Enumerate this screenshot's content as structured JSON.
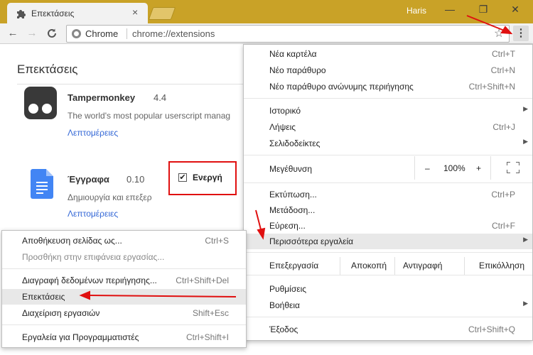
{
  "window": {
    "tab_title": "Επεκτάσεις",
    "tab_close": "×",
    "user": "Haris",
    "controls": {
      "minimize": "—",
      "maximize": "❐",
      "close": "✕"
    }
  },
  "toolbar": {
    "back": "←",
    "forward": "→",
    "reload": "C",
    "chip": "Chrome",
    "url": "chrome://extensions",
    "star": "☆",
    "menu": "⋮"
  },
  "page": {
    "title": "Επεκτάσεις",
    "extensions": [
      {
        "name": "Tampermonkey",
        "version": "4.4",
        "description": "The world's most popular userscript manag",
        "details": "Λεπτομέρειες"
      },
      {
        "name": "Έγγραφα",
        "version": "0.10",
        "description": "Δημιουργία και επεξερ",
        "details": "Λεπτομέρειες",
        "enabled_label": "Ενεργή"
      }
    ]
  },
  "main_menu": {
    "new_tab": {
      "label": "Νέα καρτέλα",
      "shortcut": "Ctrl+T"
    },
    "new_window": {
      "label": "Νέο παράθυρο",
      "shortcut": "Ctrl+N"
    },
    "incognito": {
      "label": "Νέο παράθυρο ανώνυμης περιήγησης",
      "shortcut": "Ctrl+Shift+N"
    },
    "history": {
      "label": "Ιστορικό"
    },
    "downloads": {
      "label": "Λήψεις",
      "shortcut": "Ctrl+J"
    },
    "bookmarks": {
      "label": "Σελιδοδείκτες"
    },
    "zoom": {
      "label": "Μεγέθυνση",
      "minus": "–",
      "value": "100%",
      "plus": "+"
    },
    "print": {
      "label": "Εκτύπωση...",
      "shortcut": "Ctrl+P"
    },
    "cast": {
      "label": "Μετάδοση..."
    },
    "find": {
      "label": "Εύρεση...",
      "shortcut": "Ctrl+F"
    },
    "more_tools": {
      "label": "Περισσότερα εργαλεία"
    },
    "edit": {
      "label": "Επεξεργασία",
      "cut": "Αποκοπή",
      "copy": "Αντιγραφή",
      "paste": "Επικόλληση"
    },
    "settings": {
      "label": "Ρυθμίσεις"
    },
    "help": {
      "label": "Βοήθεια"
    },
    "exit": {
      "label": "Έξοδος",
      "shortcut": "Ctrl+Shift+Q"
    },
    "arrow": "▶"
  },
  "sub_menu": {
    "save_page": {
      "label": "Αποθήκευση σελίδας ως...",
      "shortcut": "Ctrl+S"
    },
    "add_desktop": {
      "label": "Προσθήκη στην επιφάνεια εργασίας..."
    },
    "clear_data": {
      "label": "Διαγραφή δεδομένων περιήγησης...",
      "shortcut": "Ctrl+Shift+Del"
    },
    "extensions": {
      "label": "Επεκτάσεις"
    },
    "task_manager": {
      "label": "Διαχείριση εργασιών",
      "shortcut": "Shift+Esc"
    },
    "dev_tools": {
      "label": "Εργαλεία για Προγραμματιστές",
      "shortcut": "Ctrl+Shift+I"
    }
  },
  "annotation_color": "#e01010"
}
